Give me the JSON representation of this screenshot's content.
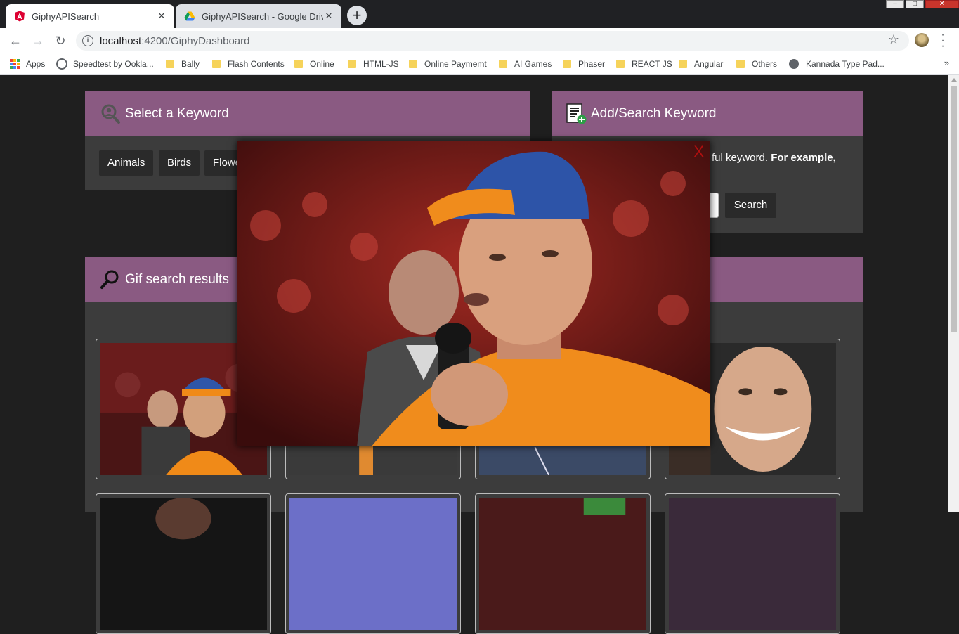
{
  "browser": {
    "tabs": [
      {
        "title": "GiphyAPISearch",
        "active": true,
        "icon": "angular-icon"
      },
      {
        "title": "GiphyAPISearch - Google Drive",
        "active": false,
        "icon": "google-drive-icon"
      }
    ],
    "url_host": "localhost",
    "url_rest": ":4200/GiphyDashboard",
    "bookmarks": [
      {
        "label": "Apps",
        "icon": "apps-grid-icon"
      },
      {
        "label": "Speedtest by Ookla...",
        "icon": "speedtest-icon"
      },
      {
        "label": "Bally",
        "icon": "folder-icon"
      },
      {
        "label": "Flash Contents",
        "icon": "folder-icon"
      },
      {
        "label": "Online",
        "icon": "folder-icon"
      },
      {
        "label": "HTML-JS",
        "icon": "folder-icon"
      },
      {
        "label": "Online Paymemt",
        "icon": "folder-icon"
      },
      {
        "label": "AI Games",
        "icon": "folder-icon"
      },
      {
        "label": "Phaser",
        "icon": "folder-icon"
      },
      {
        "label": "REACT JS",
        "icon": "folder-icon"
      },
      {
        "label": "Angular",
        "icon": "folder-icon"
      },
      {
        "label": "Others",
        "icon": "folder-icon"
      },
      {
        "label": "Kannada Type Pad...",
        "icon": "globe-icon"
      }
    ],
    "bookmarks_more": "»"
  },
  "select_panel": {
    "title": "Select a Keyword",
    "keywords": [
      "Animals",
      "Birds",
      "Flowe"
    ]
  },
  "add_panel": {
    "title": "Add/Search Keyword",
    "help_text": "ful keyword.",
    "help_bold": "For example,",
    "search_button": "Search"
  },
  "results_panel": {
    "title": "Gif search results"
  },
  "modal": {
    "close_label": "X"
  },
  "colors": {
    "panel_header": "#8a5a82",
    "panel_body": "#3c3c3c",
    "page_bg": "#1f1f1f",
    "button_bg": "#2a2a2a",
    "close_red": "#b00f0f"
  }
}
